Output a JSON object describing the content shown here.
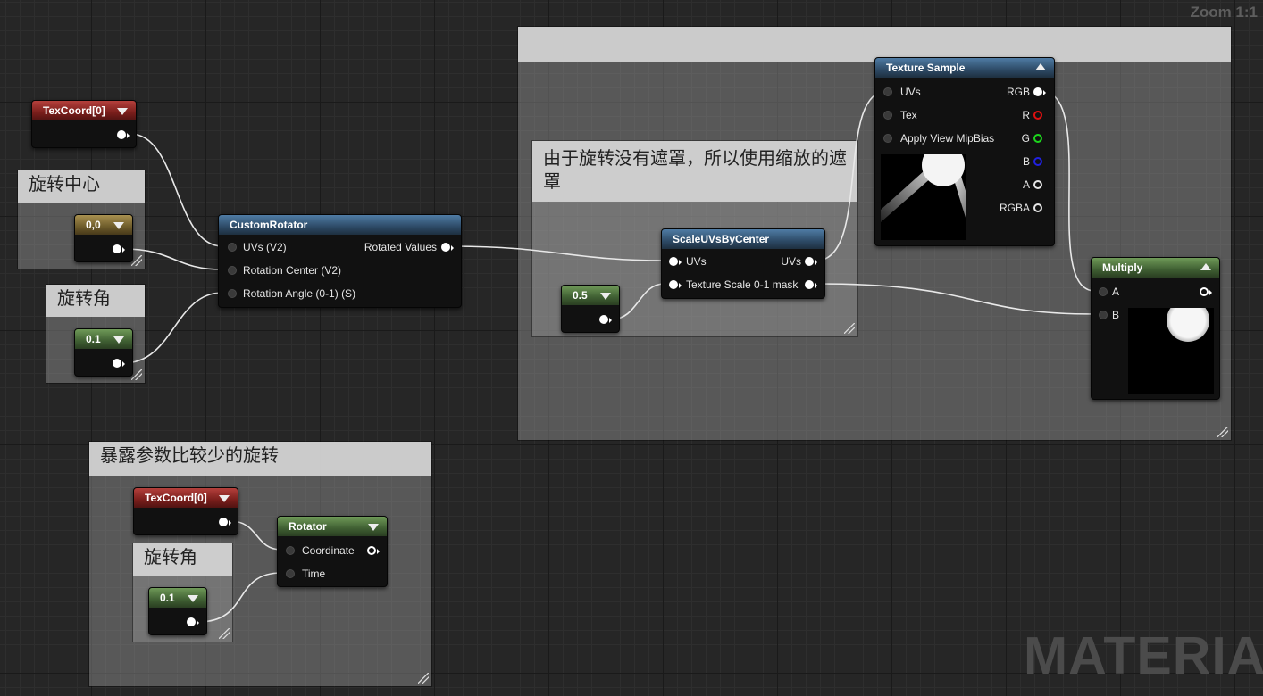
{
  "editor": {
    "zoom": "Zoom 1:1",
    "watermark": "MATERIAL"
  },
  "comments": {
    "rotation_center": "旋转中心",
    "rotation_angle": "旋转角",
    "scale_mask_note": "由于旋转没有遮罩，所以使用缩放的遮罩",
    "big_group": "",
    "simple_rotate": "暴露参数比较少的旋转",
    "rotation_angle_2": "旋转角"
  },
  "nodes": {
    "texcoord_1": {
      "title": "TexCoord[0]"
    },
    "center_const": {
      "title": "0,0"
    },
    "angle_const": {
      "title": "0.1"
    },
    "custom_rotator": {
      "title": "CustomRotator",
      "inputs": [
        "UVs (V2)",
        "Rotation Center (V2)",
        "Rotation Angle (0-1) (S)"
      ],
      "output": "Rotated Values"
    },
    "scale_const": {
      "title": "0.5"
    },
    "scale_uvs": {
      "title": "ScaleUVsByCenter",
      "inputs": [
        "UVs",
        "Texture Scale 0-1 mask"
      ],
      "outputs": [
        "UVs"
      ]
    },
    "texture_sample": {
      "title": "Texture Sample",
      "inputs": [
        "UVs",
        "Tex",
        "Apply View MipBias"
      ],
      "outputs": [
        "RGB",
        "R",
        "G",
        "B",
        "A",
        "RGBA"
      ]
    },
    "multiply": {
      "title": "Multiply",
      "inputs": [
        "A",
        "B"
      ]
    },
    "texcoord_2": {
      "title": "TexCoord[0]"
    },
    "rotator": {
      "title": "Rotator",
      "inputs": [
        "Coordinate",
        "Time"
      ]
    },
    "angle_const_2": {
      "title": "0.1"
    }
  },
  "colors": {
    "vector_header": "#2d4a66",
    "scalar_header": "#3f5f32",
    "texcoord_header": "#7a1e1b",
    "const2_header": "#6d5b2a",
    "pin_r": "#e01010",
    "pin_g": "#1cd61c",
    "pin_b": "#2020e0"
  }
}
